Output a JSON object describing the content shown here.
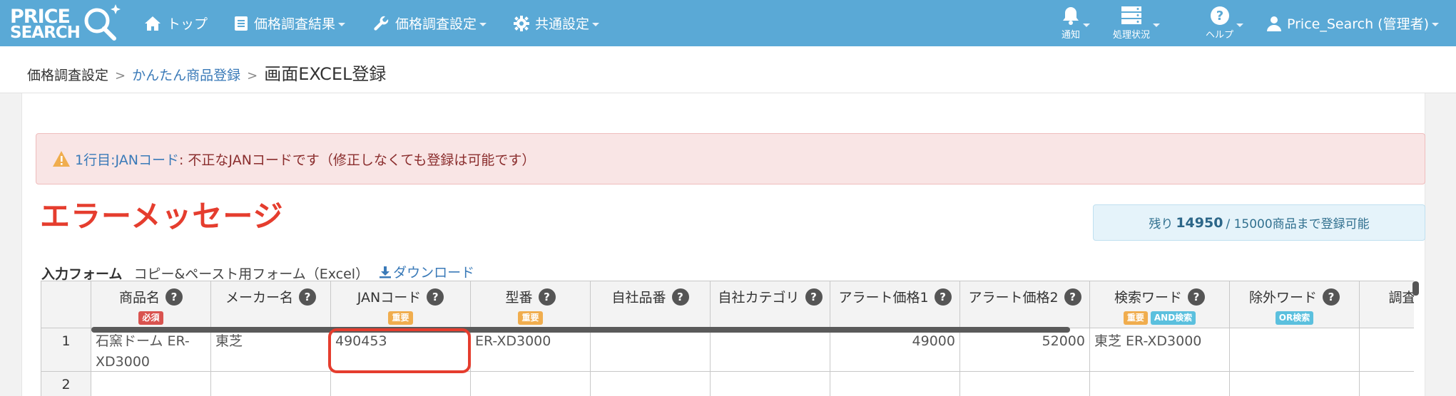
{
  "brand": {
    "logo_line1": "PRICE",
    "logo_line2": "SEARCH",
    "logo_q": "Q"
  },
  "nav": {
    "top": "トップ",
    "results": "価格調査結果",
    "settings": "価格調査設定",
    "common": "共通設定",
    "notify": "通知",
    "processing": "処理状況",
    "help": "ヘルプ",
    "user": "Price_Search (管理者)"
  },
  "breadcrumb": {
    "root": "価格調査設定",
    "sep1": ">",
    "link": "かんたん商品登録",
    "sep2": ">",
    "current": "画面EXCEL登録"
  },
  "alert": {
    "location": "1行目:JANコード",
    "message": ": 不正なJANコードです（修正しなくても登録は可能です）"
  },
  "annotation": "エラーメッセージ",
  "remaining": {
    "prefix": "残り",
    "count": "14950",
    "suffix": "/ 15000商品まで登録可能"
  },
  "form": {
    "title": "入力フォーム",
    "subtitle": "コピー&ペースト用フォーム（Excel）",
    "download": "ダウンロード"
  },
  "grid": {
    "columns": [
      {
        "label": "商品名",
        "badges": [
          {
            "text": "必須",
            "color": "red"
          }
        ]
      },
      {
        "label": "メーカー名",
        "badges": []
      },
      {
        "label": "JANコード",
        "badges": [
          {
            "text": "重要",
            "color": "orange"
          }
        ]
      },
      {
        "label": "型番",
        "badges": [
          {
            "text": "重要",
            "color": "orange"
          }
        ]
      },
      {
        "label": "自社品番",
        "badges": []
      },
      {
        "label": "自社カテゴリ",
        "badges": []
      },
      {
        "label": "アラート価格1",
        "badges": []
      },
      {
        "label": "アラート価格2",
        "badges": []
      },
      {
        "label": "検索ワード",
        "badges": [
          {
            "text": "重要",
            "color": "orange"
          },
          {
            "text": "AND検索",
            "color": "blue"
          }
        ]
      },
      {
        "label": "除外ワード",
        "badges": [
          {
            "text": "OR検索",
            "color": "blue"
          }
        ]
      },
      {
        "label": "調査",
        "badges": []
      }
    ],
    "rows": [
      {
        "num": "1",
        "cells": [
          "石窯ドーム ER-XD3000",
          "東芝",
          "490453",
          "ER-XD3000",
          "",
          "",
          "49000",
          "52000",
          "東芝 ER-XD3000",
          "",
          ""
        ]
      },
      {
        "num": "2",
        "cells": [
          "",
          "",
          "",
          "",
          "",
          "",
          "",
          "",
          "",
          "",
          ""
        ]
      }
    ],
    "help_mark": "?"
  },
  "colors": {
    "navbar": "#5aa9d6",
    "alert_bg": "#f9e5e5",
    "annotation": "#e53d2e",
    "link": "#3a7ab8"
  }
}
